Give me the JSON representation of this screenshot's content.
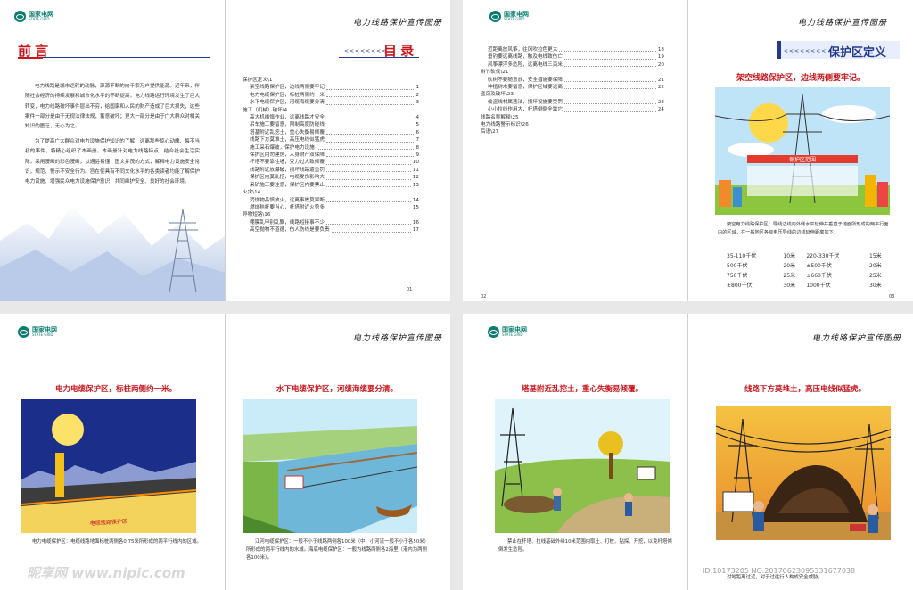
{
  "logo": {
    "cn": "国家电网",
    "en": "STATE GRID"
  },
  "brand": "电力线路保护宣传图册",
  "preface": {
    "title": "前 言",
    "paragraphs": [
      "电力线路是城市运转的动脉，源源不断的向千家万户提供能源。近年来，伴随社会经济的持续发展和城市化水平的不断提高，电力线路运行环境发生了巨大转变，电力线路破坏事件层出不穷，给国家和人民的财产造成了巨大损失，这些案件一部分是由于无视法律法规，蓄意破坏；更大一部分是由于广大群众对相关知识的匮乏，无心为之。",
      "为了提高广大群众对电力设施保护知识的了解，远离那些惊心动魄、悔不当初的事件，特精心组织了本画册。本画册针对电力线路特点，结合社会生活实际，采用漫画的彩色漫画，以通俗易懂，图文并茂的方式，解释电力设施安全常识，规范、警示不安全行为。旨在使具有不同文化水平的各类读者均能了解保护电力设施、增强民众电力设施保护意识，共同维护安全、良好的社会环境。"
    ],
    "page": "01"
  },
  "toc_left": {
    "title": "目 录",
    "arrows": "<<<<<<<<",
    "items": [
      {
        "text": "保护区定义\\1",
        "page": "",
        "level": 0
      },
      {
        "text": "架空线路保护区，边线两侧要牢记",
        "page": "1",
        "level": 1
      },
      {
        "text": "电力电缆保护区，标桩两侧约一米",
        "page": "2",
        "level": 1
      },
      {
        "text": "水下电缆保护区，河缆海缆要分清",
        "page": "3",
        "level": 1
      },
      {
        "text": "施工（机械）破坏\\4",
        "page": "",
        "level": 0
      },
      {
        "text": "高大机械慎作业，远离线路才安全",
        "page": "4",
        "level": 1
      },
      {
        "text": "吊车施工要留意，限制高度防碰线",
        "page": "5",
        "level": 1
      },
      {
        "text": "塔基附近乱挖土，重心失衡易倾覆",
        "page": "6",
        "level": 1
      },
      {
        "text": "线路下方莫堆土，高压电线似猛虎",
        "page": "7",
        "level": 1
      },
      {
        "text": "施工采石爆破，保护电力设施",
        "page": "8",
        "level": 1
      },
      {
        "text": "保护区内勿建房，人身财产双保障",
        "page": "9",
        "level": 1
      },
      {
        "text": "杆塔不要靠住墙，受力过大致倾覆",
        "page": "10",
        "level": 1
      },
      {
        "text": "线路附近放爆破，损坏线路遭重罚",
        "page": "11",
        "level": 1
      },
      {
        "text": "保护区内莫乱挖，电缆受伤影响大",
        "page": "12",
        "level": 1
      },
      {
        "text": "采矿施工要注意，保护区内要禁止",
        "page": "13",
        "level": 1
      },
      {
        "text": "火灾\\14",
        "page": "",
        "level": 0
      },
      {
        "text": "焚烧物品慎放火，远离事故莫果断",
        "page": "14",
        "level": 1
      },
      {
        "text": "燃烧秸秆要当心，杆塔附近火势多",
        "page": "15",
        "level": 1
      },
      {
        "text": "异物短路\\16",
        "page": "",
        "level": 0
      },
      {
        "text": "棚膜乱甲别乱飘，线路短接事不少",
        "page": "16",
        "level": 1
      },
      {
        "text": "高空抛物不道德，伤人伤线是要负责",
        "page": "17",
        "level": 1
      }
    ]
  },
  "toc_right": {
    "items": [
      {
        "text": "近距离放风筝，往风吹拉色更大",
        "page": "18",
        "level": 1
      },
      {
        "text": "垂钓要远离线路，触及电线致伤亡",
        "page": "19",
        "level": 1
      },
      {
        "text": "风筝漂浮多危险，远离电线三百米",
        "page": "20",
        "level": 1
      },
      {
        "text": "树竹砍伐\\21",
        "page": "",
        "level": 0
      },
      {
        "text": "砍树不要随意放，安全措施要保障",
        "page": "21",
        "level": 1
      },
      {
        "text": "种植树木要留意，保护区域要远离",
        "page": "22",
        "level": 1
      },
      {
        "text": "盗窃及破坏\\23",
        "page": "",
        "level": 0
      },
      {
        "text": "偷盗线材属违法，损坏设施要受罚",
        "page": "23",
        "level": 1
      },
      {
        "text": "小小拉线作用大，杆塔倒倒全靠它",
        "page": "24",
        "level": 1
      },
      {
        "text": "线路名称解释\\25",
        "page": "",
        "level": 0
      },
      {
        "text": "电力线路警示标识\\26",
        "page": "",
        "level": 0
      },
      {
        "text": "后语\\27",
        "page": "",
        "level": 0
      }
    ],
    "page": "02"
  },
  "protect_def": {
    "title": "保护区定义",
    "headline": "架空线路保护区，边线两侧要牢记。",
    "banner": "保护区范围",
    "caption": "架空电力线路保护区：导线边线向外侧水平延伸并垂直于地面所形成的两平行面内的区域，在一般地区各级电压导线的边线延伸距离如下：",
    "table": [
      [
        "35-110千伏",
        "10米",
        "220-330千伏",
        "15米"
      ],
      [
        "500千伏",
        "20米",
        "±500千伏",
        "20米"
      ],
      [
        "750千伏",
        "25米",
        "±660千伏",
        "25米"
      ],
      [
        "±800千伏",
        "30米",
        "1000千伏",
        "30米"
      ]
    ],
    "page": "03"
  },
  "panels": [
    {
      "headline": "电力电缆保护区，标桩两侧约一米。",
      "sign": "电缆线路保护区",
      "caption": "电力电缆保护区：电缆线路地面标桩两侧各0.75米所形成的两平行线内的区域。"
    },
    {
      "headline": "水下电缆保护区，河缆海缆要分清。",
      "caption": "江河电缆保护区：一般不小于线路两侧各100米（中、小河流一般不小于各50米）所形成的两平行线内的水域。海底电缆保护区：一般为线路两侧各2海里（港内为两侧各100米）。"
    },
    {
      "headline": "塔基附近乱挖土，重心失衡易倾覆。",
      "caption": "禁止在杆塔、拉线基础外缘10米范围内取土、打桩、钻探、开挖，以免杆塔倾倒发生危险。"
    },
    {
      "headline": "线路下方莫堆土，高压电线似猛虎。",
      "caption": "对地距离过近，对于过往行人构成安全威胁。"
    }
  ],
  "watermark": {
    "site": "昵享网 www.nipic.com",
    "id": "ID:10173205 NO:20170623095331677038"
  },
  "colors": {
    "red": "#c8161d",
    "navy": "#233a8f",
    "green": "#0a7d6e"
  }
}
